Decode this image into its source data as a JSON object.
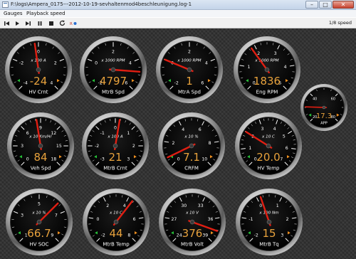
{
  "window": {
    "title": "F:\\logs\\Ampera_0175---2012-10-19-sevhaltenmod4beschleunigung.log-1"
  },
  "menu": [
    "Gauges",
    "Playback speed"
  ],
  "toolbar": {
    "buttons": [
      "skip-back",
      "play",
      "skip-forward",
      "pause",
      "stop",
      "loop",
      "record"
    ],
    "speed_label": "1/8 speed"
  },
  "colors": {
    "value": "#e8a23c",
    "needle": "#e01e12",
    "label": "#ffffff",
    "marker_green": "#27c23a",
    "marker_orange": "#f09020"
  },
  "gauges": [
    {
      "name": "HV Crnt",
      "unit": "x 100 A",
      "value": "-24",
      "ticks": [
        "-4",
        "-2",
        "0",
        "2",
        "4"
      ],
      "needle_value": -0.24,
      "min": -4,
      "max": 4
    },
    {
      "name": "MtrB Spd",
      "unit": "x 1000 RPM",
      "value": "4797",
      "ticks": [
        "-2",
        "0",
        "2",
        "4",
        "6"
      ],
      "needle_value": 4.797,
      "min": -2,
      "max": 6
    },
    {
      "name": "MtrA Spd",
      "unit": "x 1000 RPM",
      "value": "1",
      "ticks": [
        "-2",
        "0",
        "2",
        "4",
        "6"
      ],
      "needle_value": 0.001,
      "min": -2,
      "max": 6
    },
    {
      "name": "Eng RPM",
      "unit": "x 1000 RPM",
      "value": "1836",
      "ticks": [
        "0",
        "1",
        "2",
        "3",
        "4",
        "5"
      ],
      "needle_value": 1.836,
      "min": 0,
      "max": 5
    },
    {
      "name": "APP",
      "unit": "",
      "value": "17.3",
      "ticks": [
        "20",
        "40",
        "60",
        "80"
      ],
      "needle_value": 17.3,
      "min": 0,
      "max": 100
    },
    {
      "name": "Veh Spd",
      "unit": "x 10 Km/Hr",
      "value": "84",
      "ticks": [
        "0",
        "3",
        "6",
        "9",
        "12",
        "15",
        "18"
      ],
      "needle_value": 8.4,
      "min": 0,
      "max": 18
    },
    {
      "name": "MtrB Crnt",
      "unit": "x 100 A",
      "value": "21",
      "ticks": [
        "-3",
        "-2",
        "-1",
        "0",
        "1",
        "2",
        "3"
      ],
      "needle_value": 0.21,
      "min": -3,
      "max": 3
    },
    {
      "name": "CRFM",
      "unit": "x 10 %",
      "value": "7.1",
      "ticks": [
        "0",
        "2",
        "4",
        "6",
        "8",
        "10"
      ],
      "needle_value": 0.71,
      "min": 0,
      "max": 10
    },
    {
      "name": "HV Temp",
      "unit": "x 10 C",
      "value": "20.0",
      "ticks": [
        "0",
        "1",
        "2",
        "3",
        "4",
        "5",
        "6",
        "7"
      ],
      "needle_value": 2.0,
      "min": 0,
      "max": 7
    },
    {
      "name": "HV SOC",
      "unit": "x 10 %",
      "value": "66.7",
      "ticks": [
        "1",
        "3",
        "5",
        "7",
        "9"
      ],
      "needle_value": 6.67,
      "min": 0,
      "max": 10
    },
    {
      "name": "MtrB Temp",
      "unit": "x 10 C",
      "value": "44",
      "ticks": [
        "-2",
        "0",
        "2",
        "4",
        "6",
        "8"
      ],
      "needle_value": 4.4,
      "min": -2,
      "max": 8
    },
    {
      "name": "MtrB Volt",
      "unit": "x 10 V",
      "value": "376",
      "ticks": [
        "24",
        "27",
        "30",
        "33",
        "36",
        "39"
      ],
      "needle_value": 37.6,
      "min": 24,
      "max": 39
    },
    {
      "name": "MtrB Tq",
      "unit": "x 100 Nm",
      "value": "15",
      "ticks": [
        "-2",
        "-1",
        "0",
        "1",
        "2",
        "3"
      ],
      "needle_value": 0.15,
      "min": -2,
      "max": 3
    }
  ]
}
